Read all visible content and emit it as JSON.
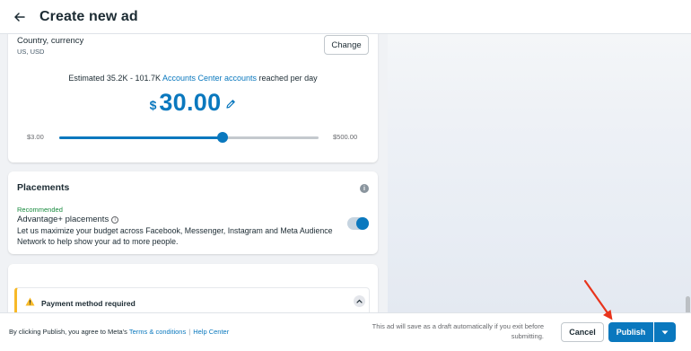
{
  "header": {
    "title": "Create new ad"
  },
  "budget": {
    "country_label": "Country, currency",
    "country_value": "US, USD",
    "change_label": "Change",
    "estimate_prefix": "Estimated 35.2K - 101.7K ",
    "estimate_link": "Accounts Center accounts",
    "estimate_suffix": " reached per day",
    "currency_symbol": "$",
    "amount": "30.00",
    "range_min": "$3.00",
    "range_max": "$500.00",
    "slider_fraction": 0.63
  },
  "placements": {
    "title": "Placements",
    "recommended": "Recommended",
    "advantage_title": "Advantage+ placements",
    "advantage_desc": "Let us maximize your budget across Facebook, Messenger, Instagram and Meta Audience Network to help show your ad to more people.",
    "toggle_on": true
  },
  "payment": {
    "warning": "Payment method required"
  },
  "footer": {
    "agree_prefix": "By clicking Publish, you agree to Meta's ",
    "terms_link": "Terms & conditions",
    "separator": "|",
    "help_link": "Help Center",
    "draft_note": "This ad will save as a draft automatically if you exit before submitting.",
    "cancel_label": "Cancel",
    "publish_label": "Publish"
  },
  "colors": {
    "accent": "#0a78be",
    "warning": "#f7b928",
    "annotation": "#e8341c"
  },
  "icons": {
    "back": "arrow-left-icon",
    "edit": "pencil-icon",
    "info": "info-icon",
    "warning": "warning-triangle-icon",
    "collapse": "chevron-up-icon",
    "dropdown": "chevron-down-icon"
  }
}
